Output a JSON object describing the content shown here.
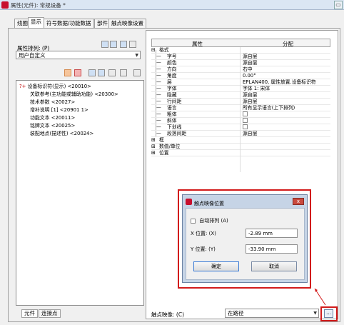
{
  "window": {
    "title": "属性(元件): 常规设备 *",
    "close_glyph": "▭"
  },
  "tabs": [
    {
      "label": "线圈"
    },
    {
      "label": "显示"
    },
    {
      "label": "符号数据/功能数据"
    },
    {
      "label": "部件"
    },
    {
      "label": "触点映像设置"
    }
  ],
  "left": {
    "arrange_label": "属性排列: (P)",
    "arrange_value": "用户自定义",
    "tree_items": [
      {
        "label": "设备标识符(显示) <20010>",
        "sub": false
      },
      {
        "label": "关联参考(主功能或辅助功能) <20300>",
        "sub": true
      },
      {
        "label": "技术参数 <20027>",
        "sub": true
      },
      {
        "label": "增补说明 [1] <20901 1>",
        "sub": true
      },
      {
        "label": "功能文本 <20011>",
        "sub": true
      },
      {
        "label": "铭牌文本 <20025>",
        "sub": true
      },
      {
        "label": "装配地点(描述性) <20024>",
        "sub": true
      }
    ],
    "bottom_tabs": [
      {
        "label": "元件"
      },
      {
        "label": "连接点"
      }
    ]
  },
  "grid": {
    "headers": {
      "property": "属性",
      "value": "分配"
    },
    "rows": [
      {
        "key": "格式",
        "value": "",
        "level": 0,
        "type": "group"
      },
      {
        "key": "字号",
        "value": "源自层",
        "level": 1
      },
      {
        "key": "颜色",
        "value": "源自层",
        "level": 1
      },
      {
        "key": "方向",
        "value": "右中",
        "level": 1
      },
      {
        "key": "角度",
        "value": "0.00°",
        "level": 1
      },
      {
        "key": "层",
        "value": "EPLAN400, 属性放置.设备标识符",
        "level": 1
      },
      {
        "key": "字体",
        "value": "字体 1: 宋体",
        "level": 1
      },
      {
        "key": "隐藏",
        "value": "源自层",
        "level": 1
      },
      {
        "key": "行间距",
        "value": "源自层",
        "level": 1
      },
      {
        "key": "语言",
        "value": "所有显示语言(上下排列)",
        "level": 1
      },
      {
        "key": "粗体",
        "value": "",
        "level": 1,
        "checkbox": true
      },
      {
        "key": "斜体",
        "value": "",
        "level": 1,
        "checkbox": true
      },
      {
        "key": "下划线",
        "value": "",
        "level": 1,
        "checkbox": true
      },
      {
        "key": "段落间距",
        "value": "源自层",
        "level": 1
      },
      {
        "key": "框",
        "value": "",
        "level": 0,
        "type": "group"
      },
      {
        "key": "数值/单位",
        "value": "",
        "level": 0,
        "type": "group"
      },
      {
        "key": "位置",
        "value": "",
        "level": 0,
        "type": "group"
      }
    ]
  },
  "dialog": {
    "title": "触点映像位置",
    "auto_label": "自动排列 (A)",
    "x_label": "X 位置: (X)",
    "x_value": "-2.89 mm",
    "y_label": "Y 位置: (Y)",
    "y_value": "-33.90 mm",
    "ok_label": "确定",
    "cancel_label": "取消",
    "close_glyph": "x"
  },
  "footer": {
    "label": "触点映像: (C)",
    "combo_value": "在路径",
    "ellipsis": "..."
  },
  "colors": {
    "highlight_red": "#d21a1a",
    "brand_red": "#c8102e"
  }
}
